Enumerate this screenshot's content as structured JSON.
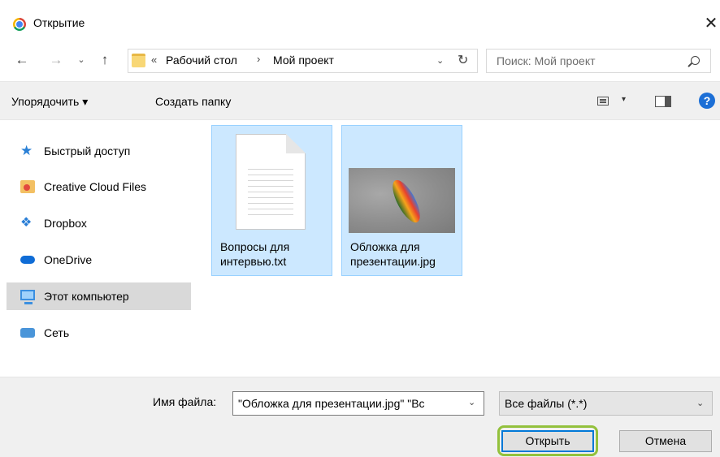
{
  "window": {
    "title": "Открытие",
    "close_glyph": "✕",
    "app_icon": "chrome-icon"
  },
  "nav": {
    "back_glyph": "←",
    "forward_glyph": "→",
    "recent_glyph": "⌄",
    "up_glyph": "↑"
  },
  "address": {
    "overflow_glyph": "«",
    "crumbs": [
      "Рабочий стол",
      "Мой проект"
    ],
    "separator": "›",
    "dropdown_glyph": "⌄",
    "refresh_glyph": "↻"
  },
  "search": {
    "placeholder": "Поиск: Мой проект"
  },
  "toolbar": {
    "organize_label": "Упорядочить ▾",
    "new_folder_label": "Создать папку",
    "view_drop_glyph": "▾",
    "help_glyph": "?"
  },
  "sidebar": {
    "items": [
      {
        "label": "Быстрый доступ",
        "icon": "quick-access-star-icon"
      },
      {
        "label": "Creative Cloud Files",
        "icon": "creative-cloud-folder-icon"
      },
      {
        "label": "Dropbox",
        "icon": "dropbox-icon"
      },
      {
        "label": "OneDrive",
        "icon": "onedrive-icon"
      },
      {
        "label": "Этот компьютер",
        "icon": "this-pc-icon",
        "selected": true
      },
      {
        "label": "Сеть",
        "icon": "network-icon"
      }
    ]
  },
  "files": [
    {
      "name_line1": "Вопросы для",
      "name_line2": "интервью.txt",
      "icon": "text-file-icon",
      "selected": true
    },
    {
      "name_line1": "Обложка для",
      "name_line2": "презентации.jpg",
      "icon": "image-thumbnail",
      "selected": true
    }
  ],
  "bottom": {
    "filename_label": "Имя файла:",
    "filename_value": "\"Обложка для презентации.jpg\" \"Вс",
    "filename_drop_glyph": "⌄",
    "filetype_value": "Все файлы (*.*)",
    "filetype_drop_glyph": "⌄",
    "open_label": "Открыть",
    "cancel_label": "Отмена"
  },
  "colors": {
    "highlight_ring": "#93c13c",
    "selection": "#cce8ff",
    "accent": "#0078d7"
  }
}
